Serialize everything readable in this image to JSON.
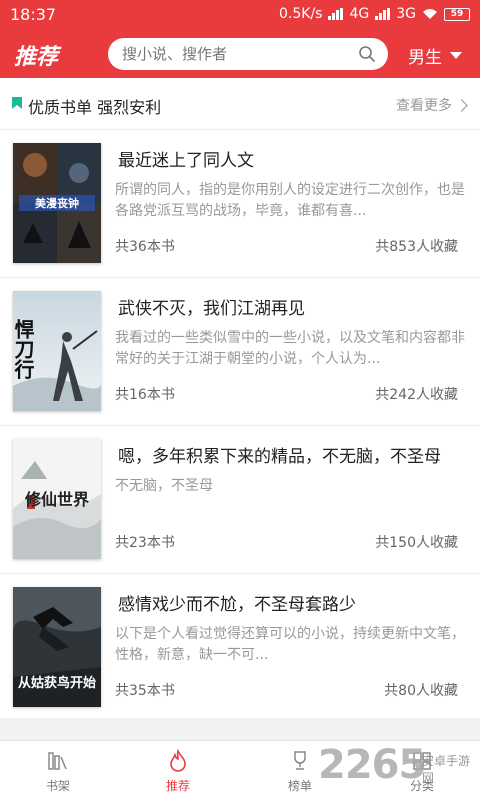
{
  "status_bar": {
    "time": "18:37",
    "speed": "0.5K/s",
    "network1": "4G",
    "network2": "3G",
    "battery": "59"
  },
  "header": {
    "title": "推荐",
    "search_placeholder": "搜小说、搜作者",
    "gender": "男生"
  },
  "section": {
    "title": "优质书单 强烈安利",
    "more_label": "查看更多"
  },
  "books": [
    {
      "title": "最近迷上了同人文",
      "desc": "所谓的同人，指的是你用别人的设定进行二次创作，也是各路党派互骂的战场，毕竟，谁都有喜...",
      "count": "共36本书",
      "fav": "共853人收藏",
      "cover_text": "美漫丧钟"
    },
    {
      "title": "武侠不灭，我们江湖再见",
      "desc": "我看过的一些类似雪中的一些小说，以及文笔和内容都非常好的关于江湖于朝堂的小说，个人认为...",
      "count": "共16本书",
      "fav": "共242人收藏",
      "cover_text": "悍刀行"
    },
    {
      "title": "嗯，多年积累下来的精品，不无脑，不圣母",
      "desc": "不无脑，不圣母",
      "count": "共23本书",
      "fav": "共150人收藏",
      "cover_text": "修仙世界"
    },
    {
      "title": "感情戏少而不尬，不圣母套路少",
      "desc": "以下是个人看过觉得还算可以的小说，持续更新中文笔，性格，新意，缺一不可...",
      "count": "共35本书",
      "fav": "共80人收藏",
      "cover_text": "从姑获鸟开始"
    }
  ],
  "nav": {
    "shelf": "书架",
    "recommend": "推荐",
    "rank": "榜单",
    "category": "分类"
  },
  "watermark": {
    "big": "2265",
    "small": "安卓手游网"
  },
  "colors": {
    "brand": "#e93b3d",
    "bookmark": "#1cb89a"
  }
}
